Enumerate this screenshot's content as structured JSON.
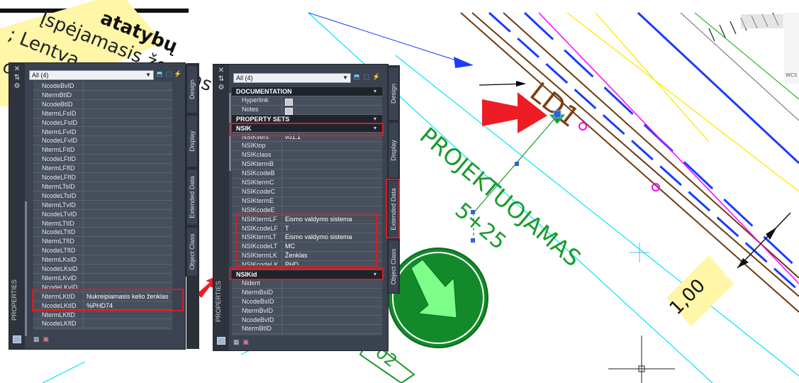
{
  "drawing": {
    "annotation_lines": [
      "Įspėjamasis ženklas",
      "atatybų",
      "; Lentva"
    ],
    "annotation_extra": "o\"",
    "street_label": "LD1",
    "projected_label": "PROJEKTUOJAMAS",
    "station_label": "5+25",
    "dimension_label": "1,00",
    "bottom_tag": "02",
    "ucs_labels": {
      "wcs": "WCS"
    }
  },
  "left_palette": {
    "title": "PROPERTIES",
    "selector": "All (4)",
    "tabs": [
      "Design",
      "Display",
      "Extended Data",
      "Object Class"
    ],
    "rows": [
      {
        "name": "NcodeBvID",
        "value": ""
      },
      {
        "name": "NtermBtID",
        "value": ""
      },
      {
        "name": "NcodeBtID",
        "value": ""
      },
      {
        "name": "NtermLFsID",
        "value": ""
      },
      {
        "name": "NcodeLFsID",
        "value": ""
      },
      {
        "name": "NtermLFvID",
        "value": ""
      },
      {
        "name": "NcodeLFvID",
        "value": ""
      },
      {
        "name": "NtermLFtID",
        "value": ""
      },
      {
        "name": "NcodeLFtID",
        "value": ""
      },
      {
        "name": "NtermLFfID",
        "value": ""
      },
      {
        "name": "NcodeLFfID",
        "value": ""
      },
      {
        "name": "NtermLTsID",
        "value": ""
      },
      {
        "name": "NcodeLTsID",
        "value": ""
      },
      {
        "name": "NtermLTvID",
        "value": ""
      },
      {
        "name": "NcodeLTvID",
        "value": ""
      },
      {
        "name": "NtermLTtID",
        "value": ""
      },
      {
        "name": "NcodeLTtID",
        "value": ""
      },
      {
        "name": "NtermLTfID",
        "value": ""
      },
      {
        "name": "NcodeLTfID",
        "value": ""
      },
      {
        "name": "NtermLKsID",
        "value": ""
      },
      {
        "name": "NcodeLKsID",
        "value": ""
      },
      {
        "name": "NtermLKvID",
        "value": ""
      },
      {
        "name": "NcodeLKvID",
        "value": ""
      },
      {
        "name": "NtermLKtID",
        "value": "Nukreipiamasis kelio ženklas"
      },
      {
        "name": "NcodeLKtID",
        "value": "%PHD74"
      },
      {
        "name": "NtermLKfID",
        "value": ""
      },
      {
        "name": "NcodeLKfID",
        "value": ""
      }
    ]
  },
  "right_palette": {
    "title": "PROPERTIES",
    "selector": "All (4)",
    "tabs": [
      "Design",
      "Display",
      "Extended Data",
      "Object Class"
    ],
    "documentation": {
      "title": "DOCUMENTATION",
      "rows": [
        {
          "name": "Hyperlink",
          "icon": "table-icon"
        },
        {
          "name": "Notes",
          "icon": "table-icon"
        }
      ]
    },
    "property_sets_title": "PROPERTY SETS",
    "nsik": {
      "title": "NSIK",
      "rows": [
        {
          "name": "NSIKvers",
          "value": "v01.1"
        },
        {
          "name": "NSIKtop",
          "value": ""
        },
        {
          "name": "NSIKclass",
          "value": ""
        },
        {
          "name": "NSIKtermB",
          "value": ""
        },
        {
          "name": "NSIKcodeB",
          "value": ""
        },
        {
          "name": "NSIKtermC",
          "value": ""
        },
        {
          "name": "NSIKcodeC",
          "value": ""
        },
        {
          "name": "NSIKtermE",
          "value": ""
        },
        {
          "name": "NSIKcodeE",
          "value": ""
        },
        {
          "name": "NSIKtermLF",
          "value": "Eismo valdymo sistema"
        },
        {
          "name": "NSIKcodeLF",
          "value": "T"
        },
        {
          "name": "NSIKtermLT",
          "value": "Eismo valdymo sistema"
        },
        {
          "name": "NSIKcodeLT",
          "value": "MC"
        },
        {
          "name": "NSIKtermLK",
          "value": "Ženklas"
        },
        {
          "name": "NSIKcodeLK",
          "value": "PHD"
        }
      ]
    },
    "nsikid": {
      "title": "NSIKid",
      "rows": [
        {
          "name": "Nident",
          "value": ""
        },
        {
          "name": "NtermBsID",
          "value": ""
        },
        {
          "name": "NcodeBsID",
          "value": ""
        },
        {
          "name": "NtermBvID",
          "value": ""
        },
        {
          "name": "NcodeBvID",
          "value": ""
        },
        {
          "name": "NtermBtID",
          "value": ""
        }
      ]
    }
  },
  "colors": {
    "highlight": "#cf2027",
    "palette_bg": "#3b4250",
    "cyan_line": "#00e5ff",
    "green_text": "#1a9a2c",
    "circle_green": "#138a2a"
  }
}
